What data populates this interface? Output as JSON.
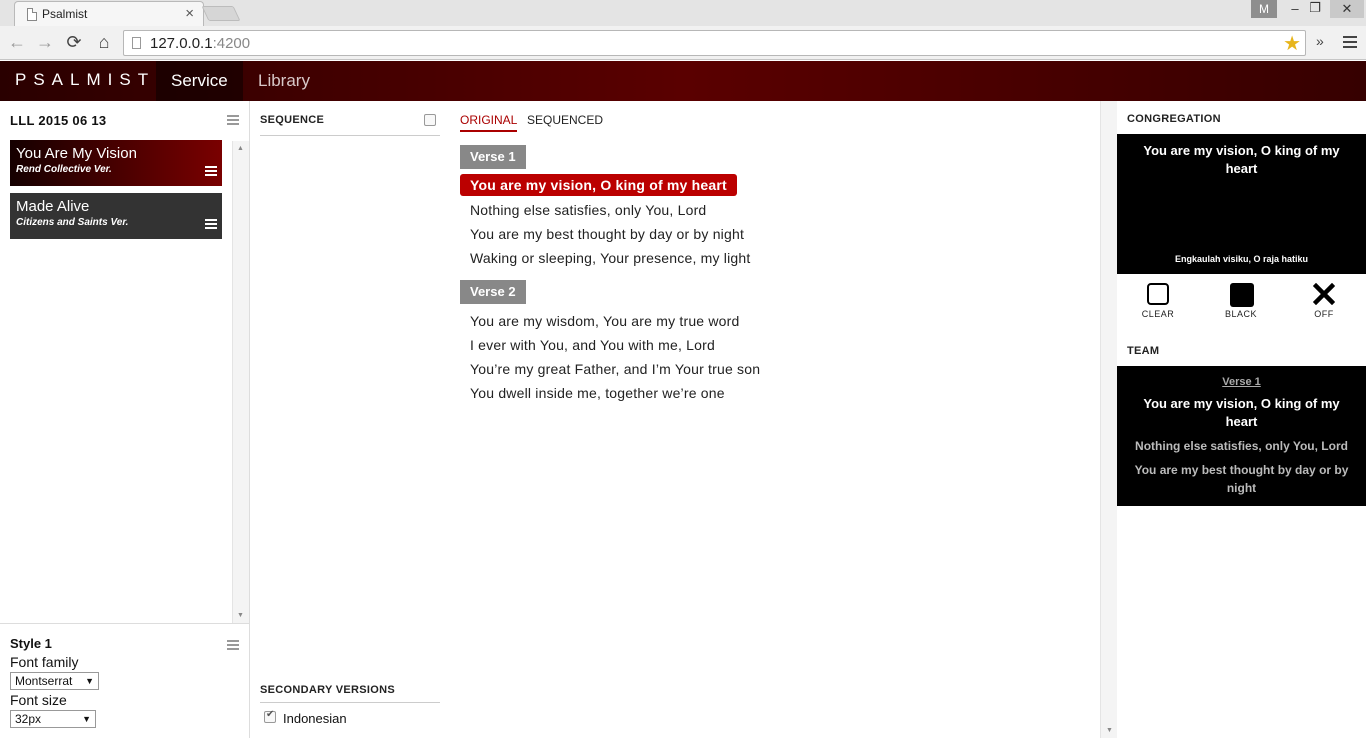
{
  "browser": {
    "tab_title": "Psalmist",
    "tab_close": "×",
    "profile_letter": "M",
    "url_host": "127.0.0.1",
    "url_port": ":4200",
    "back_icon": "←",
    "forward_icon": "→",
    "reload_icon": "⟳",
    "home_icon": "⌂",
    "star_icon": "★",
    "extensions_chevron": "»",
    "minimize": "–",
    "restore": "❐",
    "close": "✕"
  },
  "appnav": {
    "brand": "PSALMIST",
    "tabs": [
      {
        "label": "Service",
        "active": true
      },
      {
        "label": "Library",
        "active": false
      }
    ]
  },
  "service": {
    "title": "LLL 2015 06 13",
    "songs": [
      {
        "title": "You Are My Vision",
        "version": "Rend Collective Ver.",
        "active": true
      },
      {
        "title": "Made Alive",
        "version": "Citizens and Saints Ver.",
        "active": false
      }
    ]
  },
  "style": {
    "title": "Style 1",
    "font_family_label": "Font family",
    "font_family_value": "Montserrat",
    "font_size_label": "Font size",
    "font_size_value": "32px"
  },
  "sequence": {
    "heading": "SEQUENCE",
    "checked": false,
    "secondary_heading": "SECONDARY VERSIONS",
    "secondary_versions": [
      {
        "label": "Indonesian",
        "checked": true
      }
    ]
  },
  "lyrics": {
    "tabs": [
      {
        "label": "ORIGINAL",
        "active": true
      },
      {
        "label": "SEQUENCED",
        "active": false
      }
    ],
    "verses": [
      {
        "label": "Verse 1",
        "lines": [
          {
            "text": "You are my vision, O king of my heart",
            "selected": true
          },
          {
            "text": "Nothing else satisfies, only You, Lord",
            "selected": false
          },
          {
            "text": "You are my best thought by day or by night",
            "selected": false
          },
          {
            "text": "Waking or sleeping, Your presence, my light",
            "selected": false
          }
        ]
      },
      {
        "label": "Verse 2",
        "lines": [
          {
            "text": "You are my wisdom, You are my true word",
            "selected": false
          },
          {
            "text": "I ever with You, and You with me, Lord",
            "selected": false
          },
          {
            "text": "You’re my great Father, and I’m Your true son",
            "selected": false
          },
          {
            "text": "You dwell inside me, together we’re one",
            "selected": false
          }
        ]
      }
    ]
  },
  "congregation": {
    "heading": "CONGREGATION",
    "main_text": "You are my vision, O king of my heart",
    "secondary_text": "Engkaulah visiku, O raja hatiku",
    "controls": [
      {
        "label": "CLEAR",
        "icon": "empty-square-icon"
      },
      {
        "label": "BLACK",
        "icon": "filled-square-icon"
      },
      {
        "label": "OFF",
        "icon": "x-icon"
      }
    ]
  },
  "team": {
    "heading": "TEAM",
    "verse_label": "Verse 1",
    "current_line": "You are my vision, O king of my heart",
    "next_lines": [
      "Nothing else satisfies, only You, Lord",
      "You are my best thought by day or by night"
    ]
  },
  "colors": {
    "accent": "#aa0000",
    "nav_dark": "#2a0000",
    "preview_bg": "#000000",
    "verse_label_bg": "#888888"
  }
}
